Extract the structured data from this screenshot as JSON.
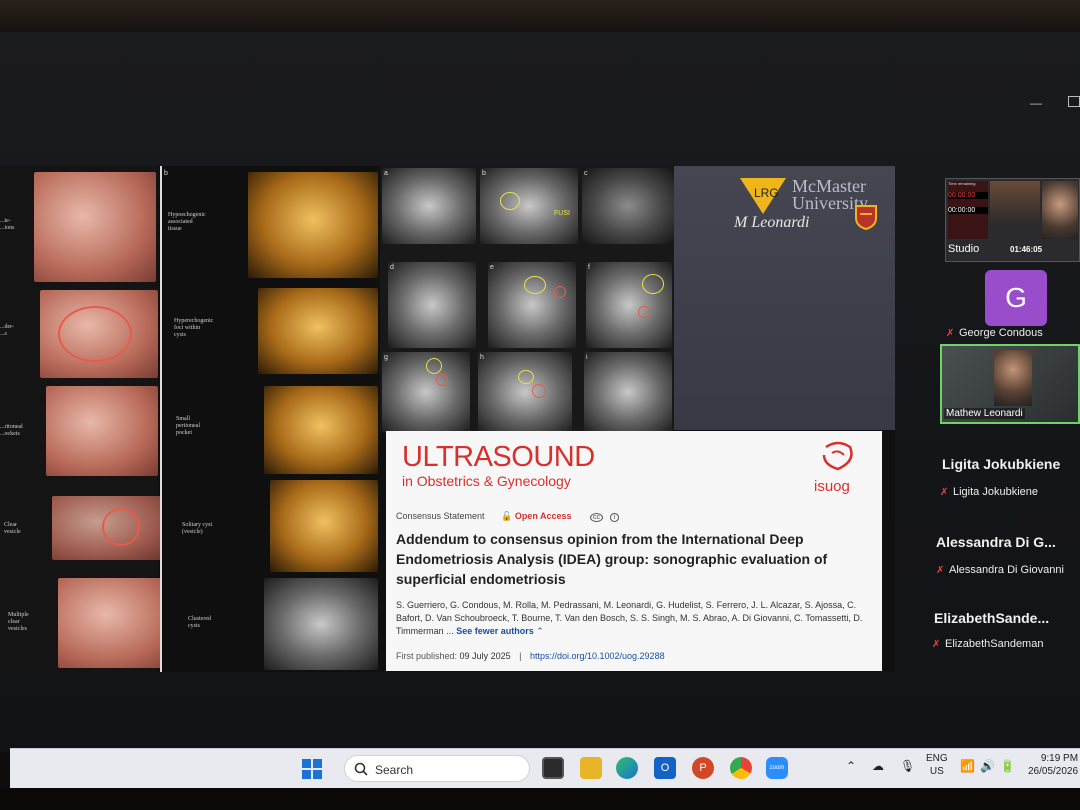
{
  "slide": {
    "panel_a_labels": [
      "...te-\n...ions",
      "...der-\n...s",
      "...ritoneal\n...ockets",
      "Clear\nvesicle",
      "Multiple\nclear\nvesicles"
    ],
    "panel_b_letter": "b",
    "panel_b_labels": [
      "Hypoechogenic\nassociated\ntissue",
      "Hyperechogenic\nfoci within\ncysts",
      "Small\nperitoneal\npocket",
      "Solitary cyst\n(vesicle)",
      "Clustered\ncysts"
    ],
    "panel_c_letters": [
      "a",
      "b",
      "c",
      "d",
      "e",
      "f",
      "g",
      "h",
      "i"
    ],
    "panel_c_label": "FUSI",
    "university": "McMaster\nUniversity",
    "signature": "M Leonardi",
    "paper": {
      "journal": "ULTRASOUND",
      "journal_sub": "in Obstetrics & Gynecology",
      "society": "isuog",
      "type": "Consensus Statement",
      "access": "Open Access",
      "title": "Addendum to consensus opinion from the International Deep Endometriosis Analysis (IDEA) group: sonographic evaluation of superficial endometriosis",
      "authors": "S. Guerriero, G. Condous, M. Rolla, M. Pedrassani, M. Leonardi, G. Hudelist, S. Ferrero, J. L. Alcazar, S. Ajossa, C. Bafort, D. Van Schoubroeck, T. Bourne, T. Van den Bosch, S. S. Singh, M. S. Abrao, A. Di Giovanni, C. Tomassetti, D. Timmerman ...",
      "see_fewer": "See fewer authors",
      "published_label": "First published:",
      "published_date": "09 July 2025",
      "doi": "https://doi.org/10.1002/uog.29288"
    }
  },
  "zoom": {
    "studio_label": "Studio",
    "time_remaining": "Time remaining",
    "timer_a": "00:00:00",
    "timer_b": "00:00:00",
    "elapsed": "01:46:05",
    "participants": [
      {
        "name": "George Condous",
        "avatar": "G"
      },
      {
        "name": "Mathew Leonardi"
      },
      {
        "name": "Ligita Jokubkiene",
        "tile_name": "Ligita Jokubkiene"
      },
      {
        "name": "Alessandra Di Giovanni",
        "tile_name": "Alessandra Di G..."
      },
      {
        "name": "ElizabethSandeman",
        "tile_name": "ElizabethSande..."
      }
    ]
  },
  "taskbar": {
    "search_label": "Search",
    "lang": "ENG",
    "region": "US",
    "time": "9:19 PM",
    "date": "26/05/2026",
    "zoom_icon_text": "zoom"
  },
  "colors": {
    "journal_red": "#d8302c",
    "speaking_border": "#6fd36a",
    "avatar_purple": "#9a4dcb"
  }
}
